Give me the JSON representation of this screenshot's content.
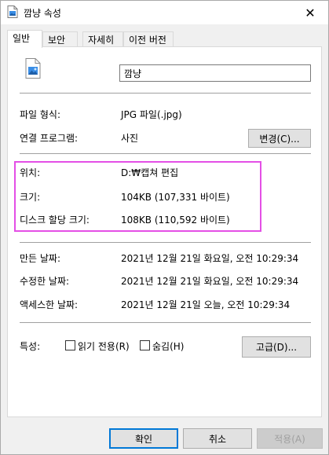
{
  "window": {
    "title": "깜냥 속성",
    "close_glyph": "✕"
  },
  "tabs": [
    {
      "label": "일반",
      "active": true
    },
    {
      "label": "보안",
      "active": false
    },
    {
      "label": "자세히",
      "active": false
    },
    {
      "label": "이전 버전",
      "active": false
    }
  ],
  "file": {
    "name": "깜냥",
    "icon": "image-file-icon"
  },
  "general": {
    "type_label": "파일 형식:",
    "type_value": "JPG 파일(.jpg)",
    "opens_label": "연결 프로그램:",
    "opens_value": "사진",
    "change_button": "변경(C)..."
  },
  "location": {
    "location_label": "위치:",
    "location_value": "D:₩캡쳐 편집",
    "size_label": "크기:",
    "size_value": "104KB (107,331 바이트)",
    "disk_label": "디스크 할당 크기:",
    "disk_value": "108KB (110,592 바이트)"
  },
  "dates": {
    "created_label": "만든 날짜:",
    "created_value": "2021년 12월 21일 화요일, 오전 10:29:34",
    "modified_label": "수정한 날짜:",
    "modified_value": "2021년 12월 21일 화요일, 오전 10:29:34",
    "accessed_label": "액세스한 날짜:",
    "accessed_value": "2021년 12월 21일 오늘, 오전 10:29:34"
  },
  "attributes": {
    "label": "특성:",
    "readonly_label": "읽기 전용(R)",
    "readonly_checked": false,
    "hidden_label": "숨김(H)",
    "hidden_checked": false,
    "advanced_button": "고급(D)..."
  },
  "footer": {
    "ok": "확인",
    "cancel": "취소",
    "apply": "적용(A)"
  },
  "colors": {
    "highlight_border": "#e44fe6",
    "default_button_border": "#0078d7"
  }
}
